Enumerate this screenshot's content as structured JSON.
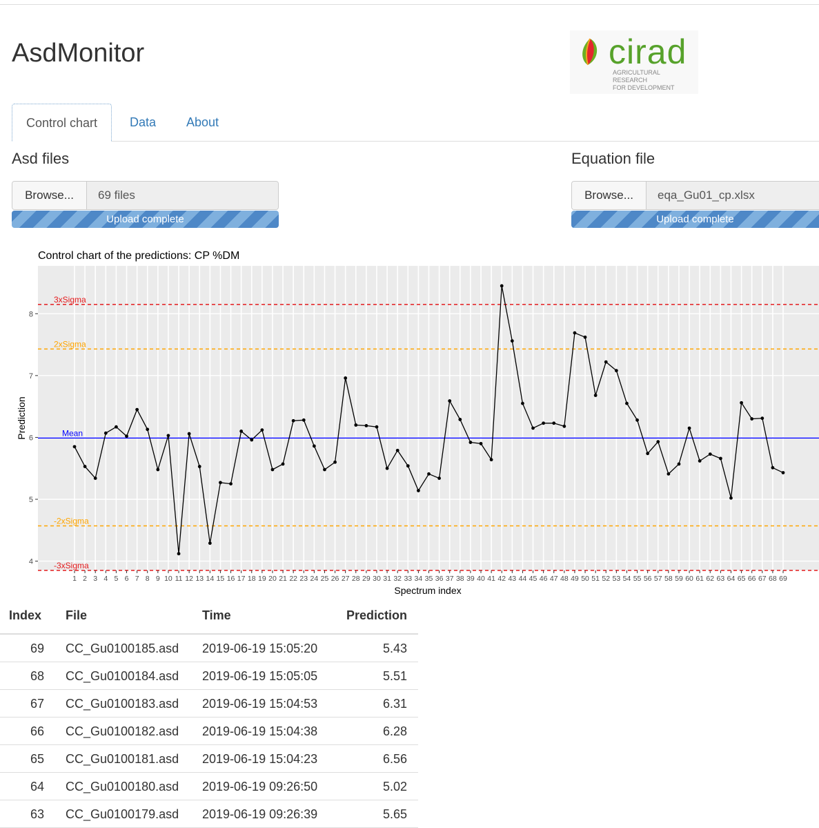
{
  "app": {
    "title": "AsdMonitor"
  },
  "logo": {
    "name": "cirad",
    "tagline_1": "AGRICULTURAL RESEARCH",
    "tagline_2": "FOR DEVELOPMENT"
  },
  "tabs": [
    {
      "label": "Control chart",
      "active": true
    },
    {
      "label": "Data",
      "active": false
    },
    {
      "label": "About",
      "active": false
    }
  ],
  "asd_files": {
    "label": "Asd files",
    "browse_label": "Browse...",
    "value": "69 files",
    "progress_text": "Upload complete"
  },
  "equation_file": {
    "label": "Equation file",
    "browse_label": "Browse...",
    "value": "eqa_Gu01_cp.xlsx",
    "progress_text": "Upload complete"
  },
  "chart_title": "Control chart of the predictions:  CP %DM",
  "colors": {
    "link": "#337ab7",
    "progress": "#4e88c7",
    "sigma3": "#e41a1c",
    "sigma2": "#ffa500",
    "mean": "#0000ff",
    "panel": "#ebebeb"
  },
  "chart_data": {
    "type": "line",
    "xlabel": "Spectrum index",
    "ylabel": "Prediction",
    "x": [
      1,
      2,
      3,
      4,
      5,
      6,
      7,
      8,
      9,
      10,
      11,
      12,
      13,
      14,
      15,
      16,
      17,
      18,
      19,
      20,
      21,
      22,
      23,
      24,
      25,
      26,
      27,
      28,
      29,
      30,
      31,
      32,
      33,
      34,
      35,
      36,
      37,
      38,
      39,
      40,
      41,
      42,
      43,
      44,
      45,
      46,
      47,
      48,
      49,
      50,
      51,
      52,
      53,
      54,
      55,
      56,
      57,
      58,
      59,
      60,
      61,
      62,
      63,
      64,
      65,
      66,
      67,
      68,
      69
    ],
    "y": [
      5.85,
      5.53,
      5.34,
      6.07,
      6.17,
      6.02,
      6.45,
      6.13,
      5.48,
      6.03,
      4.12,
      6.06,
      5.53,
      4.29,
      5.27,
      5.25,
      6.1,
      5.96,
      6.12,
      5.48,
      5.57,
      6.27,
      6.28,
      5.86,
      5.48,
      5.6,
      6.96,
      6.2,
      6.19,
      6.17,
      5.5,
      5.79,
      5.54,
      5.14,
      5.41,
      5.34,
      6.59,
      6.29,
      5.92,
      5.9,
      5.64,
      8.45,
      7.56,
      6.55,
      6.15,
      6.23,
      6.23,
      6.18,
      7.69,
      7.62,
      6.68,
      7.22,
      7.08,
      6.55,
      6.28,
      5.74,
      5.93,
      5.41,
      5.57,
      6.15,
      5.62,
      5.73,
      5.66,
      5.02,
      6.56,
      6.3,
      6.31,
      5.51,
      5.43
    ],
    "ylim": [
      3.85,
      8.55
    ],
    "yticks": [
      4,
      5,
      6,
      7,
      8
    ],
    "reference_lines": [
      {
        "label": "3xSigma",
        "value": 8.15,
        "color": "#e41a1c"
      },
      {
        "label": "2xSigma",
        "value": 7.43,
        "color": "#ffa500"
      },
      {
        "label": "Mean",
        "value": 5.99,
        "color": "#0000ff"
      },
      {
        "label": "-2xSigma",
        "value": 4.57,
        "color": "#ffa500"
      },
      {
        "label": "-3xSigma",
        "value": 3.85,
        "color": "#e41a1c"
      }
    ],
    "grid": true
  },
  "table": {
    "headers": {
      "index": "Index",
      "file": "File",
      "time": "Time",
      "prediction": "Prediction"
    },
    "rows": [
      {
        "index": "69",
        "file": "CC_Gu0100185.asd",
        "time": "2019-06-19 15:05:20",
        "prediction": "5.43"
      },
      {
        "index": "68",
        "file": "CC_Gu0100184.asd",
        "time": "2019-06-19 15:05:05",
        "prediction": "5.51"
      },
      {
        "index": "67",
        "file": "CC_Gu0100183.asd",
        "time": "2019-06-19 15:04:53",
        "prediction": "6.31"
      },
      {
        "index": "66",
        "file": "CC_Gu0100182.asd",
        "time": "2019-06-19 15:04:38",
        "prediction": "6.28"
      },
      {
        "index": "65",
        "file": "CC_Gu0100181.asd",
        "time": "2019-06-19 15:04:23",
        "prediction": "6.56"
      },
      {
        "index": "64",
        "file": "CC_Gu0100180.asd",
        "time": "2019-06-19 09:26:50",
        "prediction": "5.02"
      },
      {
        "index": "63",
        "file": "CC_Gu0100179.asd",
        "time": "2019-06-19 09:26:39",
        "prediction": "5.65"
      }
    ]
  }
}
